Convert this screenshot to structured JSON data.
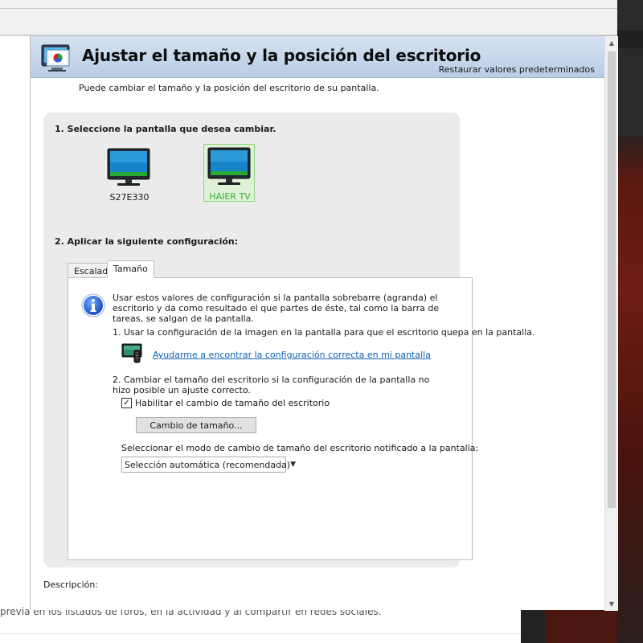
{
  "header": {
    "title": "Ajustar el tamaño y la posición del escritorio",
    "restore_label": "Restaurar valores predeterminados"
  },
  "subtitle": "Puede cambiar el tamaño y la posición del escritorio de su pantalla.",
  "step1": {
    "heading": "1. Seleccione la pantalla que desea cambiar.",
    "displays": [
      {
        "name": "S27E330",
        "selected": false
      },
      {
        "name": "HAIER TV",
        "selected": true
      }
    ]
  },
  "step2": {
    "heading": "2. Aplicar la siguiente configuración:",
    "tabs": [
      {
        "label": "Escalado",
        "active": false
      },
      {
        "label": "Tamaño",
        "active": true
      }
    ],
    "info_text": "Usar estos valores de configuración si la pantalla sobrebarre (agranda) el escritorio y da como resultado el que partes de éste, tal como la barra de tareas, se salgan de la pantalla.",
    "step_a": "1. Usar la configuración de la imagen en la pantalla para que el escritorio quepa en la pantalla.",
    "help_link": "Ayudarme a encontrar la configuración correcta en mi pantalla",
    "step_b": "2. Cambiar el tamaño del escritorio si la configuración de la pantalla no hizo posible un ajuste correcto.",
    "enable_checkbox": {
      "label": "Habilitar el cambio de tamaño del escritorio",
      "checked": true,
      "mark": "✓"
    },
    "resize_button": "Cambio de tamaño...",
    "mode_label": "Seleccionar el modo de cambio de tamaño del escritorio notificado a la pantalla:",
    "mode_select": {
      "value": "Selección automática (recomendada)"
    }
  },
  "description_label": "Descripción:",
  "background": {
    "bottom_text": "previa en los listados de foros, en la actividad y al compartir en redes sociales."
  },
  "colors": {
    "header_gradient_top": "#d6e2f0",
    "header_gradient_bottom": "#b9cde6",
    "selected_display_text": "#33b233",
    "link": "#0e5fb3"
  }
}
